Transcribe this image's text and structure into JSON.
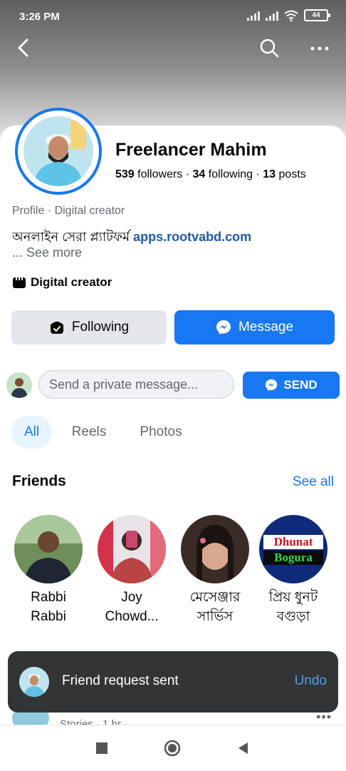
{
  "status_bar": {
    "time": "3:26 PM",
    "battery": "44"
  },
  "profile": {
    "name": "Freelancer Mahim",
    "followers_count": "539",
    "followers_label": "followers",
    "following_count": "34",
    "following_label": "following",
    "posts_count": "13",
    "posts_label": "posts",
    "subline": "Profile · Digital creator",
    "bio_text": "অনলাইন সেরা প্ল্যাটফর্ম",
    "bio_link": "apps.rootvabd.com",
    "see_more": "... See more",
    "category": "Digital creator"
  },
  "actions": {
    "following_label": "Following",
    "message_label": "Message"
  },
  "private_message": {
    "placeholder": "Send a private message...",
    "send_label": "SEND"
  },
  "tabs": [
    {
      "label": "All"
    },
    {
      "label": "Reels"
    },
    {
      "label": "Photos"
    }
  ],
  "friends": {
    "title": "Friends",
    "see_all": "See all",
    "items": [
      {
        "name": "Rabbi Rabbi"
      },
      {
        "name": "Joy Chowd..."
      },
      {
        "name": "মেসেঞ্জার সার্ভিস"
      },
      {
        "name": "প্রিয় ধুনট বগুড়া",
        "pic_line1": "Dhunat",
        "pic_line2": "Bogura"
      }
    ]
  },
  "toast": {
    "message": "Friend request sent",
    "undo_label": "Undo"
  },
  "peek_post": {
    "meta": "Stories · 1 hr ·"
  },
  "colors": {
    "accent": "#1877f2",
    "toast_bg": "#323436",
    "undo": "#4b9df5"
  }
}
